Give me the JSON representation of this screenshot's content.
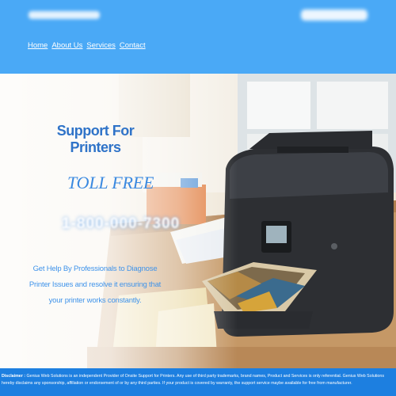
{
  "header": {
    "site_name": "Genius Web Solutions",
    "phone_masked": "1-800-000-0000"
  },
  "nav": {
    "items": [
      "Home",
      "About Us",
      "Services",
      "Contact"
    ]
  },
  "hero": {
    "title": "Support For Printers",
    "toll_free_label": "TOLL FREE",
    "phone_number": "1-800-000-7300",
    "tagline": "Get Help By Professionals to Diagnose Printer Issues and resolve it ensuring that your printer works constantly."
  },
  "footer": {
    "disclaimer_label": "Disclaimer :",
    "disclaimer_text": "Genius Web Solutions is an independent Provider of Onsite Support for Printers. Any use of third party trademarks, brand names, Product and Services is only referential. Genius Web Solutions hereby disclaims any sponsorship, affiliation or endorsement of or by any third parties. If your product is covered by warranty, the support service maybe available for free from manufacturer."
  },
  "colors": {
    "header_bg": "#4aa9f6",
    "accent_blue": "#2f73c8",
    "footer_bg": "#1d7fe0"
  }
}
